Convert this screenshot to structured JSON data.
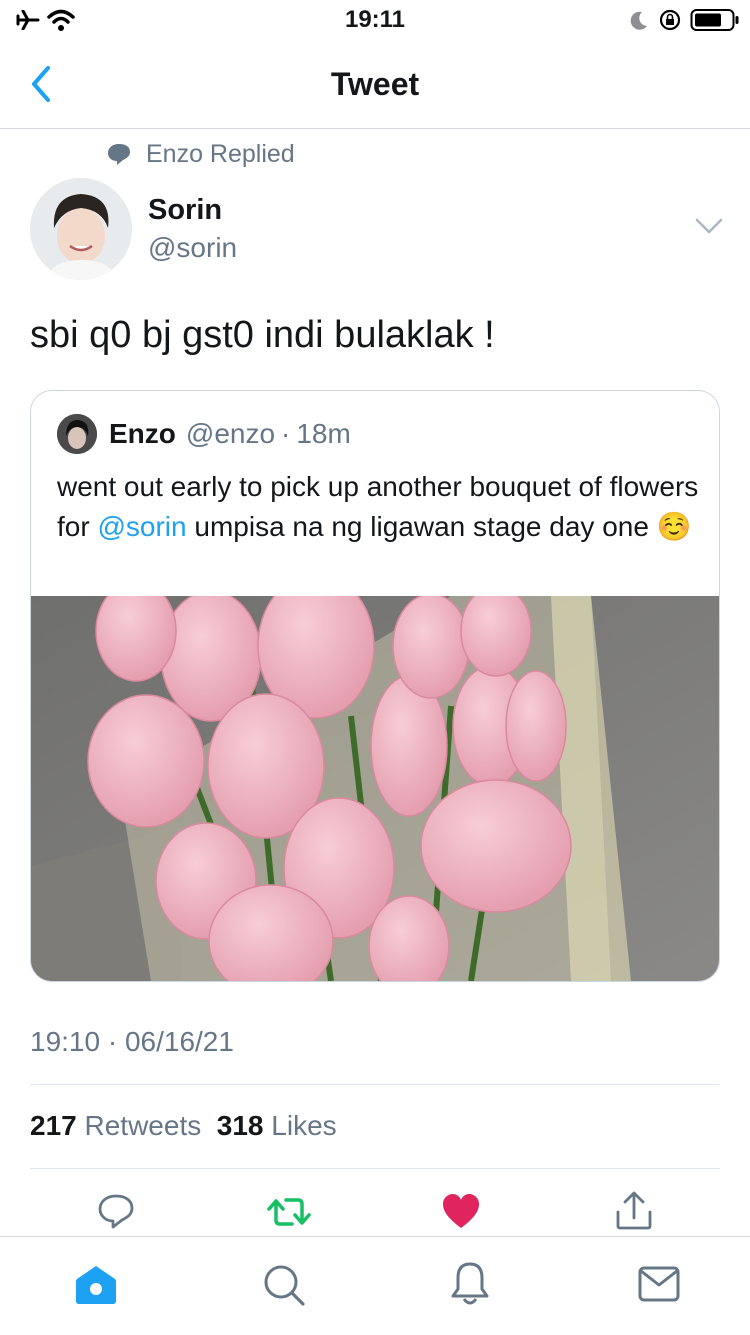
{
  "status_bar": {
    "time": "19:11"
  },
  "nav": {
    "title": "Tweet"
  },
  "context": {
    "replied_label": "Enzo Replied"
  },
  "author": {
    "name": "Sorin",
    "handle": "@sorin"
  },
  "tweet": {
    "text": "sbi q0 bj gst0 indi bulaklak !"
  },
  "quote": {
    "name": "Enzo",
    "handle": "@enzo",
    "separator": "·",
    "time": "18m",
    "text_before": "went out early to pick up another bouquet of flowers for ",
    "mention": "@sorin",
    "text_after": " umpisa na ng ligawan stage day one ☺️"
  },
  "meta": {
    "timestamp": "19:10 · 06/16/21"
  },
  "stats": {
    "retweets_count": "217",
    "retweets_label": "Retweets",
    "likes_count": "318",
    "likes_label": "Likes"
  },
  "icons": {
    "reply": "comment-bubble-icon",
    "retweet": "retweet-icon",
    "like": "heart-icon",
    "share": "share-icon",
    "home": "home-icon",
    "search": "search-icon",
    "notifications": "bell-icon",
    "messages": "envelope-icon"
  },
  "colors": {
    "accent": "#1da1f2",
    "retweet": "#17bf63",
    "like": "#e0245e",
    "muted": "#657786"
  }
}
